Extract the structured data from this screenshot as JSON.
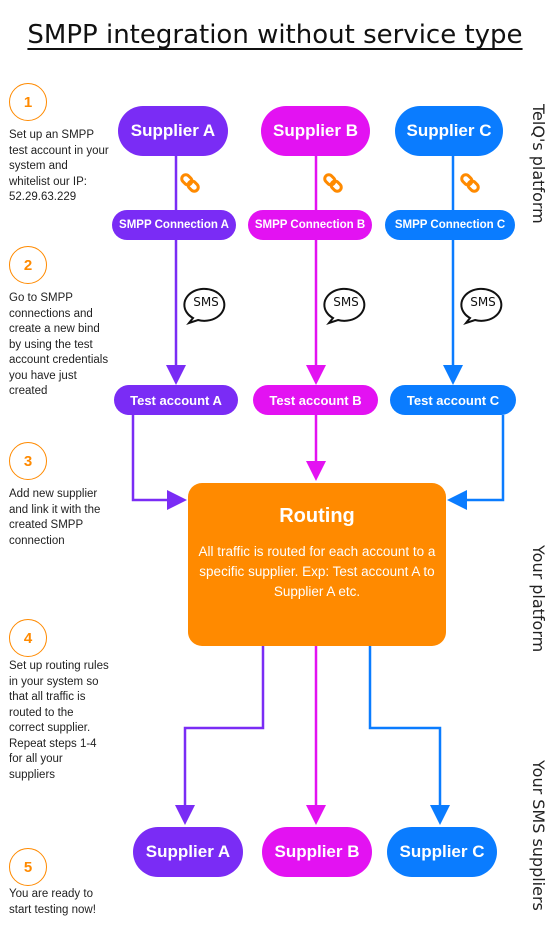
{
  "title": "SMPP integration without service type",
  "colors": {
    "supplier_a": "#7a2cf5",
    "supplier_b": "#e312f2",
    "supplier_c": "#0a7cff",
    "accent": "#ff8a00"
  },
  "steps": [
    {
      "number": "1",
      "text": "Set up an SMPP test account in your system and whitelist our IP: 52.29.63.229"
    },
    {
      "number": "2",
      "text": "Go to SMPP connections and create a new bind by using the test account credentials you have just created"
    },
    {
      "number": "3",
      "text": "Add new supplier and link it with the created SMPP connection"
    },
    {
      "number": "4",
      "text": "Set up routing rules in your system so that all traffic is routed to the correct supplier. Repeat steps 1-4 for all your suppliers"
    },
    {
      "number": "5",
      "text": "You are ready to start testing now!"
    }
  ],
  "top_suppliers": [
    "Supplier A",
    "Supplier B",
    "Supplier C"
  ],
  "connections": [
    "SMPP Connection A",
    "SMPP Connection B",
    "SMPP Connection C"
  ],
  "sms_label": "SMS",
  "test_accounts": [
    "Test account A",
    "Test account B",
    "Test account C"
  ],
  "routing": {
    "title": "Routing",
    "description": "All traffic is routed for each account to a specific supplier. Exp: Test account A to Supplier A etc."
  },
  "bottom_suppliers": [
    "Supplier A",
    "Supplier B",
    "Supplier C"
  ],
  "section_labels": {
    "telq": "TelQ's platform",
    "yours": "Your platform",
    "suppliers": "Your SMS suppliers"
  },
  "icons": {
    "link": "link-chain-icon",
    "sms": "sms-speech-bubble-icon"
  }
}
